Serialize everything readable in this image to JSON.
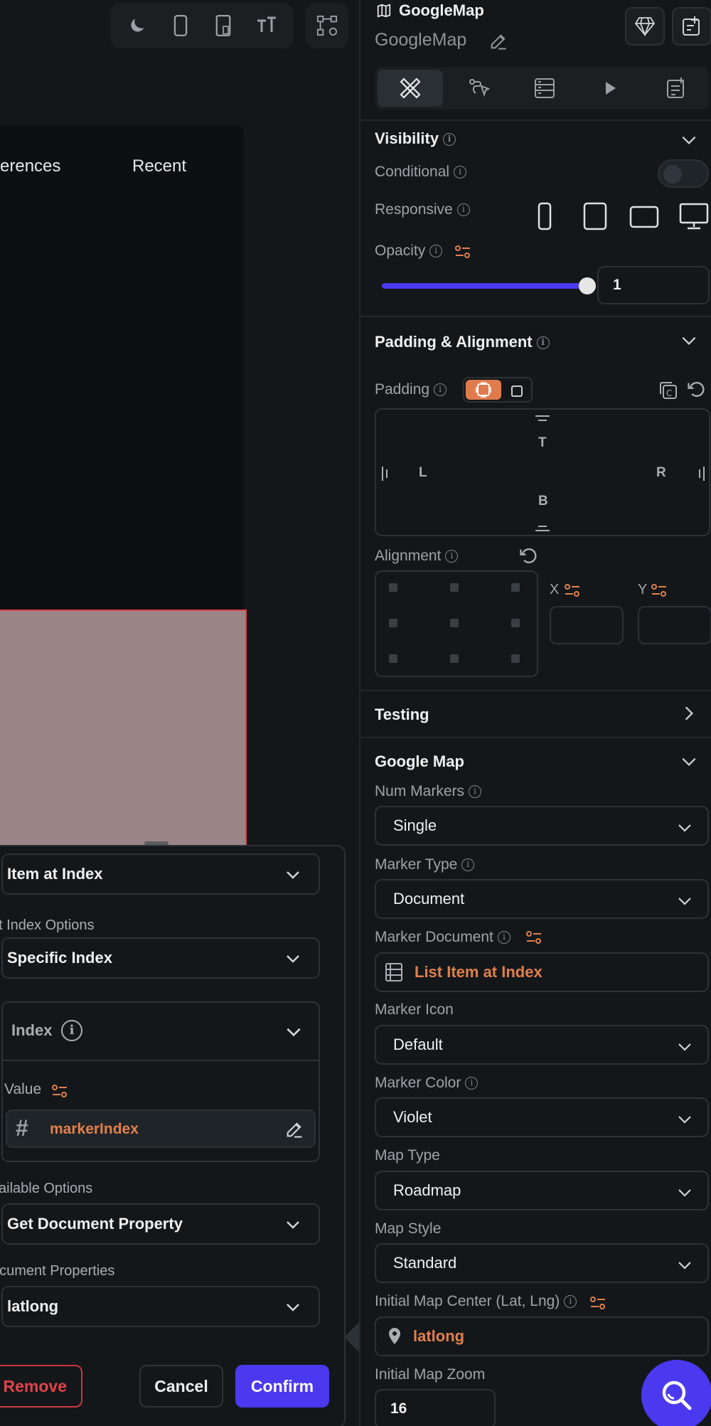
{
  "canvas": {
    "toolbar_icons": [
      "moon-icon",
      "phone-icon",
      "tablet-icon",
      "text-size-icon",
      "widget-tree-icon"
    ],
    "tabs": [
      "erences",
      "Recent"
    ]
  },
  "popup": {
    "source_select": "Item at Index",
    "list_index_options_label": "st Index Options",
    "list_index_options_value": "Specific Index",
    "index_title": "Index",
    "value_label": "Value",
    "value_field": "markerIndex",
    "available_options_label": "vailable Options",
    "available_options_value": "Get Document Property",
    "document_properties_label": "ocument Properties",
    "document_properties_value": "latlong",
    "remove_label": "Remove",
    "cancel_label": "Cancel",
    "confirm_label": "Confirm"
  },
  "panel": {
    "widget_type": "GoogleMap",
    "widget_name": "GoogleMap",
    "tabs": [
      "properties-icon",
      "actions-icon",
      "backend-query-icon",
      "play-icon",
      "notes-icon"
    ],
    "visibility": {
      "title": "Visibility",
      "conditional_label": "Conditional",
      "conditional_on": false,
      "responsive_label": "Responsive",
      "opacity_label": "Opacity",
      "opacity_value": "1",
      "opacity_fraction": 1.0
    },
    "padding_alignment": {
      "title": "Padding & Alignment",
      "padding_label": "Padding",
      "top": "T",
      "left": "L",
      "right": "R",
      "bottom": "B",
      "alignment_label": "Alignment",
      "x_label": "X",
      "y_label": "Y"
    },
    "testing": {
      "title": "Testing"
    },
    "google_map": {
      "title": "Google Map",
      "num_markers_label": "Num Markers",
      "num_markers_value": "Single",
      "marker_type_label": "Marker Type",
      "marker_type_value": "Document",
      "marker_document_label": "Marker Document",
      "marker_document_value": "List Item at Index",
      "marker_icon_label": "Marker Icon",
      "marker_icon_value": "Default",
      "marker_color_label": "Marker Color",
      "marker_color_value": "Violet",
      "map_type_label": "Map Type",
      "map_type_value": "Roadmap",
      "map_style_label": "Map Style",
      "map_style_value": "Standard",
      "initial_center_label": "Initial Map Center (Lat, Lng)",
      "initial_center_value": "latlong",
      "initial_zoom_label": "Initial Map Zoom",
      "initial_zoom_value": "16"
    }
  },
  "colors": {
    "background": "#14171a",
    "accent": "#4b39ef",
    "orange": "#e0804c",
    "danger": "#e0444a",
    "border": "#2c3136"
  }
}
